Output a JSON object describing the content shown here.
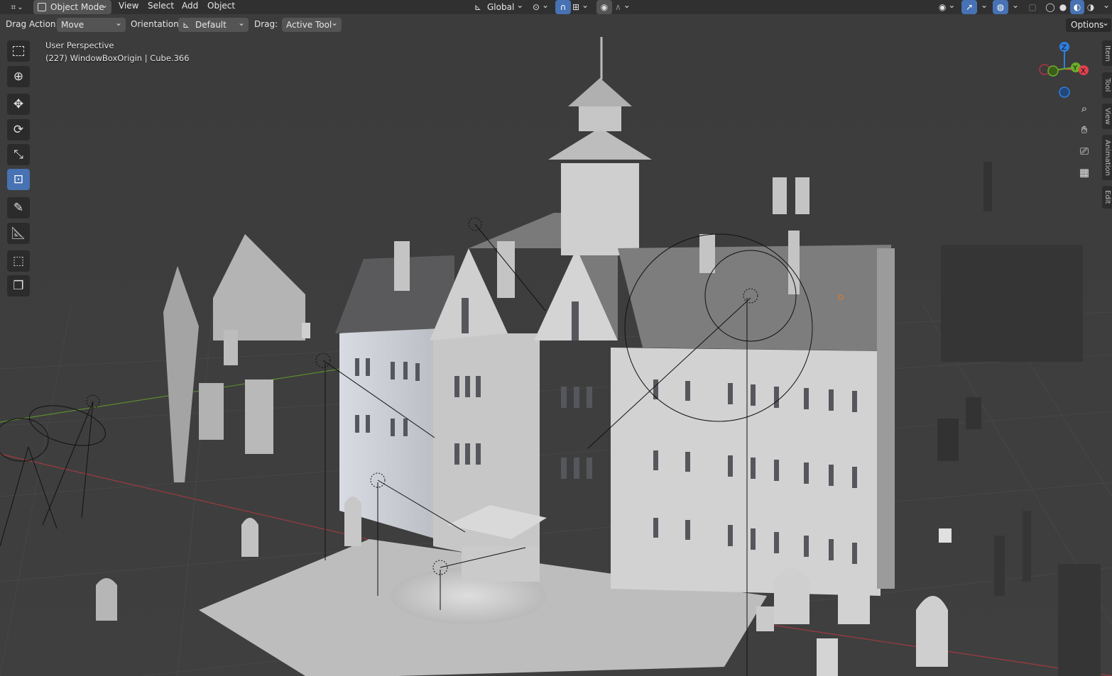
{
  "header": {
    "editor_icon": "editor-type-icon",
    "mode_label": "Object Mode",
    "menus": [
      "View",
      "Select",
      "Add",
      "Object"
    ],
    "transform_orientation": "Global"
  },
  "tool_options": {
    "drag_action_label": "Drag Action:",
    "drag_action_value": "Move",
    "orientation_label": "Orientation:",
    "orientation_value": "Default",
    "drag_label": "Drag:",
    "drag_value": "Active Tool",
    "options_label": "Options"
  },
  "viewport": {
    "perspective_label": "User Perspective",
    "object_info": "(227) WindowBoxOrigin | Cube.366"
  },
  "gizmo": {
    "z_label": "Z",
    "y_label": "Y",
    "x_label": "X",
    "colors": {
      "x": "#e0404f",
      "y": "#6cad2a",
      "z": "#2f7fe0"
    }
  },
  "sidebar_tabs": [
    "Item",
    "Tool",
    "View",
    "Animation",
    "Edit"
  ],
  "toolbar_tools": [
    "select-box",
    "cursor",
    "move",
    "rotate",
    "scale",
    "transform",
    "annotate",
    "measure",
    "add-cube",
    "add-object"
  ],
  "colors": {
    "accent": "#4772b3",
    "background": "#3a3a3a",
    "header": "#303030"
  }
}
